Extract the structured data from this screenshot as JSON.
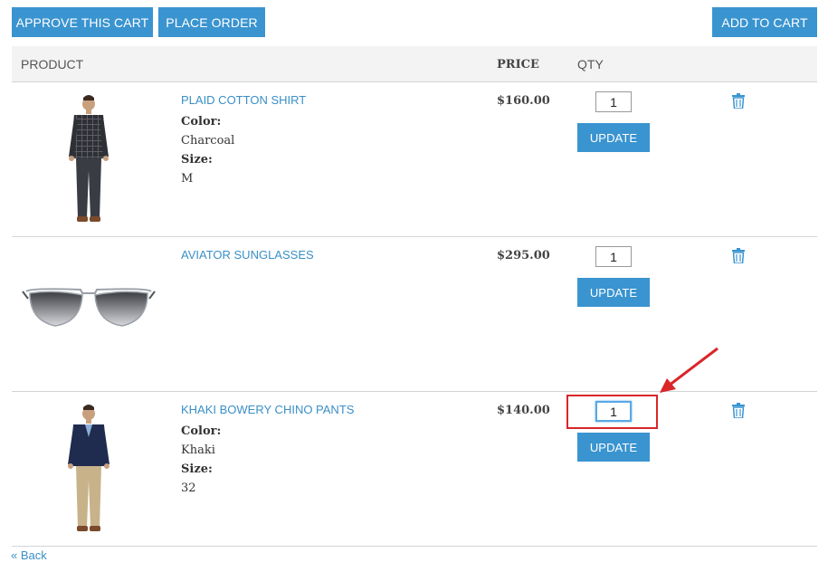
{
  "toolbar": {
    "approve_label": "APPROVE THIS CART",
    "place_order_label": "PLACE ORDER",
    "add_to_cart_label": "ADD TO CART"
  },
  "table": {
    "headers": {
      "product": "PRODUCT",
      "price": "PRICE",
      "qty": "QTY"
    },
    "rows": [
      {
        "name": "PLAID COTTON SHIRT",
        "color_label": "Color:",
        "color": "Charcoal",
        "size_label": "Size:",
        "size": "M",
        "price": "$160.00",
        "qty": "1",
        "update_label": "UPDATE",
        "image": "man-in-plaid-shirt"
      },
      {
        "name": "AVIATOR SUNGLASSES",
        "price": "$295.00",
        "qty": "1",
        "update_label": "UPDATE",
        "image": "aviator-sunglasses"
      },
      {
        "name": "KHAKI BOWERY CHINO PANTS",
        "color_label": "Color:",
        "color": "Khaki",
        "size_label": "Size:",
        "size": "32",
        "price": "$140.00",
        "qty": "1",
        "update_label": "UPDATE",
        "image": "man-in-blazer-and-khakis"
      }
    ]
  },
  "back_link": "« Back",
  "icons": {
    "delete": "trash-icon"
  },
  "colors": {
    "accent": "#3a94d0",
    "link": "#3a8fc7",
    "annotation": "#d9262a"
  }
}
